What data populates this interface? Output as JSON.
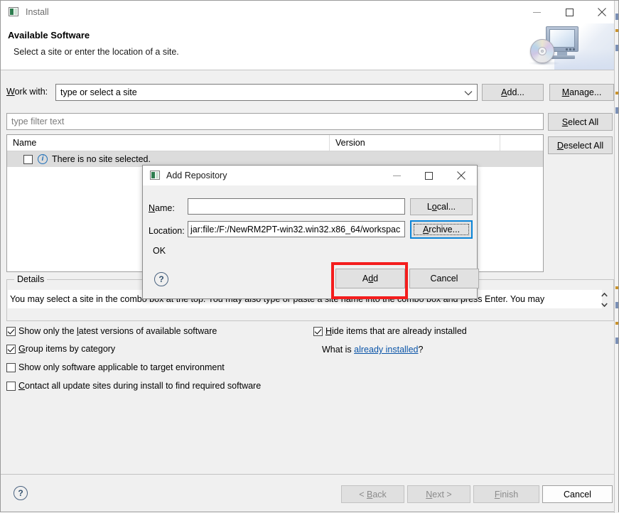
{
  "window": {
    "title": "Install",
    "icon": "install-icon",
    "controls": {
      "minimize": "minimize-icon",
      "maximize": "maximize-icon",
      "close": "close-icon"
    }
  },
  "header": {
    "title": "Available Software",
    "subtitle": "Select a site or enter the location of a site.",
    "banner_icon": "monitor-with-cd-icon"
  },
  "work_with": {
    "label": "Work with:",
    "label_mnemonic": "W",
    "combo_value": "type or select a site",
    "combo_placeholder": "type or select a site",
    "add_button": "Add...",
    "manage_button": "Manage..."
  },
  "filter": {
    "placeholder": "type filter text",
    "value": ""
  },
  "list_actions": {
    "select_all": "Select All",
    "deselect_all": "Deselect All"
  },
  "table": {
    "columns": [
      "Name",
      "Version"
    ],
    "rows": [
      {
        "name": "There is no site selected.",
        "version": "",
        "checked": false,
        "icon": "info-icon"
      }
    ]
  },
  "details": {
    "legend": "Details",
    "text": "You may select a site in the combo box at the top.  You may also type or paste a site name into the combo box and press Enter.  You may",
    "spinner": "scroll-arrows-icon"
  },
  "options": {
    "left": [
      {
        "label": "Show only the latest versions of available software",
        "checked": true,
        "mnemonic": "l"
      },
      {
        "label": "Group items by category",
        "checked": true,
        "mnemonic": "G"
      },
      {
        "label": "Show only software applicable to target environment",
        "checked": false,
        "mnemonic": ""
      },
      {
        "label": "Contact all update sites during install to find required software",
        "checked": false,
        "mnemonic": "C"
      }
    ],
    "right": [
      {
        "label": "Hide items that are already installed",
        "checked": true,
        "mnemonic": "H"
      }
    ],
    "what_is_prefix": "What is ",
    "what_is_link": "already installed",
    "what_is_suffix": "?"
  },
  "footer": {
    "help": "?",
    "back": "< Back",
    "next": "Next >",
    "finish": "Finish",
    "cancel": "Cancel"
  },
  "dialog": {
    "title": "Add Repository",
    "icon": "install-icon",
    "controls": {
      "minimize": "minimize-icon",
      "maximize": "maximize-icon",
      "close": "close-icon"
    },
    "name_label": "Name:",
    "name_value": "",
    "location_label": "Location:",
    "location_value": "jar:file:/F:/NewRM2PT-win32.win32.x86_64/workspac",
    "local_button": "Local...",
    "archive_button": "Archive...",
    "status_text": "OK",
    "help": "?",
    "add_button": "Add",
    "cancel_button": "Cancel"
  },
  "annotation": {
    "highlight_target": "Add",
    "highlight_color": "#f41d1d"
  }
}
